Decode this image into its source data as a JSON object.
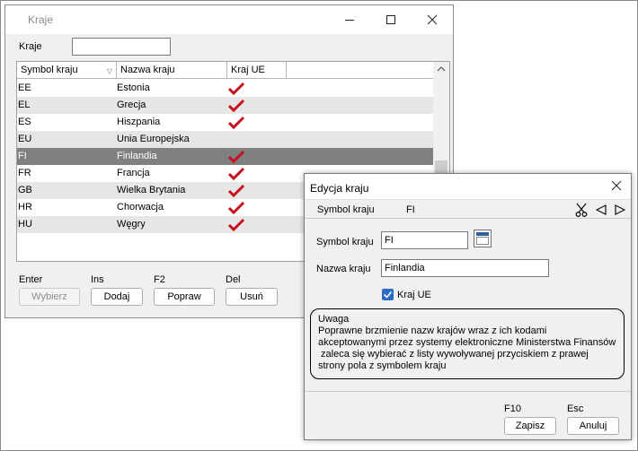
{
  "main_window": {
    "title": "Kraje",
    "filter_label": "Kraje",
    "filter_value": "",
    "columns": {
      "code": "Symbol kraju",
      "name": "Nazwa kraju",
      "eu": "Kraj UE"
    },
    "rows": [
      {
        "code": "EE",
        "name": "Estonia",
        "eu": true
      },
      {
        "code": "EL",
        "name": "Grecja",
        "eu": true
      },
      {
        "code": "ES",
        "name": "Hiszpania",
        "eu": true
      },
      {
        "code": "EU",
        "name": "Unia Europejska",
        "eu": false
      },
      {
        "code": "FI",
        "name": "Finlandia",
        "eu": true,
        "selected": true
      },
      {
        "code": "FR",
        "name": "Francja",
        "eu": true
      },
      {
        "code": "GB",
        "name": "Wielka Brytania",
        "eu": true
      },
      {
        "code": "HR",
        "name": "Chorwacja",
        "eu": true
      },
      {
        "code": "HU",
        "name": "Węgry",
        "eu": true
      }
    ],
    "shortcuts": {
      "select_key": "Enter",
      "add_key": "Ins",
      "edit_key": "F2",
      "delete_key": "Del"
    },
    "buttons": {
      "select": "Wybierz",
      "add": "Dodaj",
      "edit": "Popraw",
      "delete": "Usuń"
    }
  },
  "dialog": {
    "title": "Edycja kraju",
    "info_label": "Symbol kraju",
    "info_value": "FI",
    "symbol_label": "Symbol kraju",
    "symbol_value": "FI",
    "name_label": "Nazwa kraju",
    "name_value": "Finlandia",
    "eu_label": "Kraj UE",
    "eu_checked": true,
    "note_title": "Uwaga",
    "note_lines": [
      "Poprawne brzmienie nazw krajów wraz z ich kodami",
      "akceptowanymi przez systemy elektroniczne Ministerstwa Finansów",
      " zaleca się wybierać z listy wywoływanej przyciskiem z prawej",
      "strony pola z symbolem kraju"
    ],
    "save_key": "F10",
    "cancel_key": "Esc",
    "save_label": "Zapisz",
    "cancel_label": "Anuluj"
  },
  "colors": {
    "check_red": "#c8101f",
    "selected_row": "#808080",
    "alt_row": "#e6e6e6",
    "checkbox_blue": "#2b6cc4"
  },
  "icons": [
    "minimize-icon",
    "maximize-icon",
    "close-icon",
    "sort-icon",
    "checkmark-icon",
    "scissors-icon",
    "prev-arrow-icon",
    "next-arrow-icon",
    "calendar-picker-icon"
  ]
}
